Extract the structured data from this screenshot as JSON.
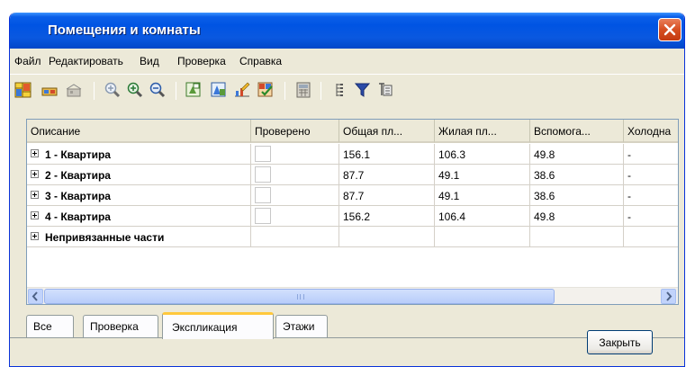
{
  "window": {
    "title": "Помещения и комнаты",
    "close_icon": "close-icon",
    "close_color": "#d64e21"
  },
  "menu": {
    "items": [
      "Файл",
      "Редактировать",
      "Вид",
      "Проверка",
      "Справка"
    ]
  },
  "toolbar": {
    "icons": [
      "plan-icon",
      "room-icon",
      "room-disabled-icon",
      "zoom-icon",
      "zoom-in-icon",
      "zoom-out-icon",
      "area-icon-1",
      "area-icon-2",
      "chart-icon",
      "check-icon",
      "calculator-icon",
      "list-icon",
      "filter-icon",
      "tree-icon"
    ]
  },
  "table": {
    "columns": [
      "Описание",
      "Проверено",
      "Общая пл...",
      "Жилая пл...",
      "Вспомога...",
      "Холодна"
    ],
    "rows": [
      {
        "label": "1 - Квартира",
        "total": "156.1",
        "living": "106.3",
        "aux": "49.8",
        "cold": "-"
      },
      {
        "label": "2 - Квартира",
        "total": "87.7",
        "living": "49.1",
        "aux": "38.6",
        "cold": "-"
      },
      {
        "label": "3 - Квартира",
        "total": "87.7",
        "living": "49.1",
        "aux": "38.6",
        "cold": "-"
      },
      {
        "label": "4 - Квартира",
        "total": "156.2",
        "living": "106.4",
        "aux": "49.8",
        "cold": "-"
      },
      {
        "label": "Непривязанные части",
        "total": "",
        "living": "",
        "aux": "",
        "cold": ""
      }
    ]
  },
  "tabs": [
    "Все",
    "Проверка",
    "Экспликация",
    "Этажи"
  ],
  "active_tab": "Экспликация",
  "close_button": "Закрыть"
}
